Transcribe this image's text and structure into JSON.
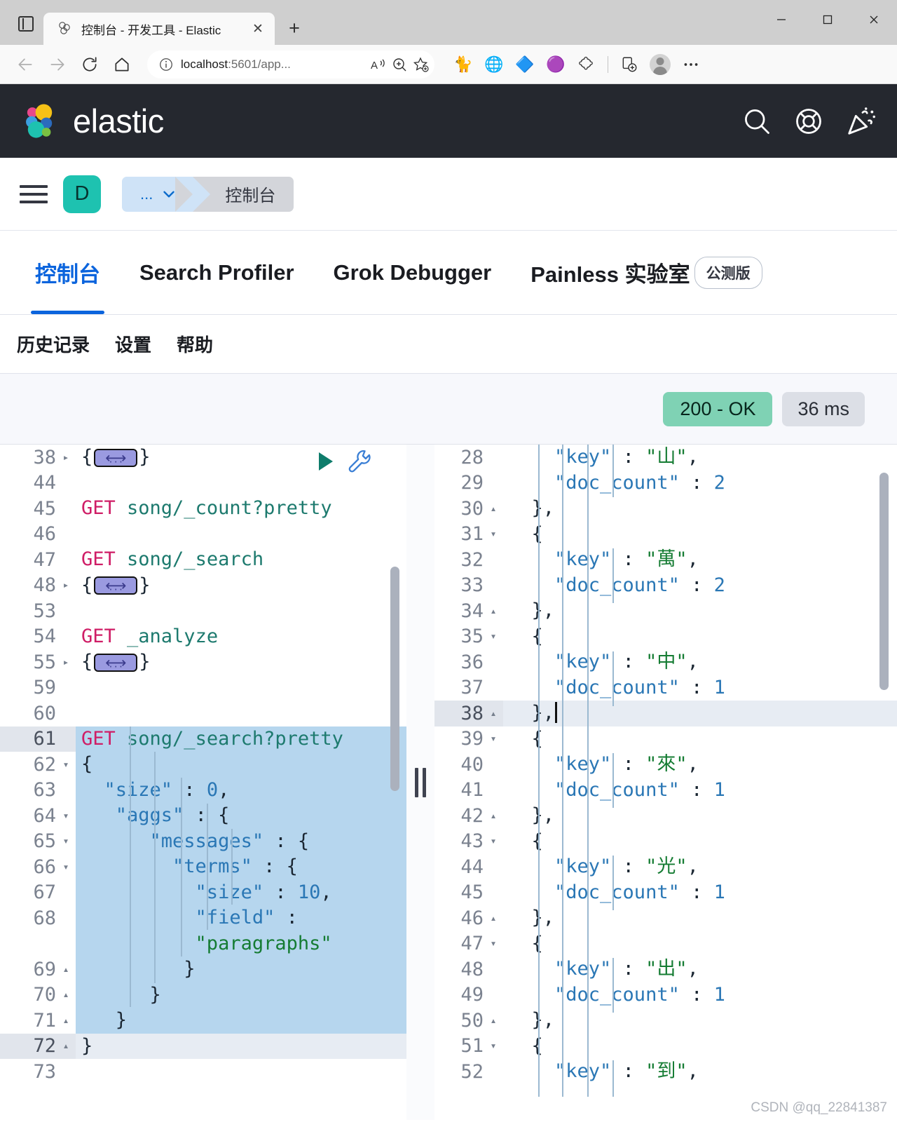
{
  "browser": {
    "tab_title": "控制台 - 开发工具 - Elastic",
    "url_main": "localhost",
    "url_rest": ":5601/app...",
    "new_tab_label": "+",
    "close_label": "✕",
    "back_icon": "back-arrow-icon",
    "forward_icon": "forward-arrow-icon",
    "reload_icon": "reload-icon",
    "home_icon": "home-icon",
    "info_icon": "info-circle-icon",
    "read_aloud_icon": "read-aloud-icon",
    "zoom_icon": "zoom-icon",
    "favorite_icon": "add-favorite-icon",
    "extensions": [
      {
        "name": "cat-extension-icon",
        "glyph": "🐈"
      },
      {
        "name": "idm-extension-icon",
        "glyph": "🌐"
      },
      {
        "name": "diamond-extension-icon",
        "glyph": "🔷"
      },
      {
        "name": "purple-extension-icon",
        "glyph": "🟣"
      },
      {
        "name": "puzzle-extensions-icon",
        "glyph": "🧩"
      }
    ],
    "collections_icon": "collections-icon",
    "profile_icon": "profile-avatar-icon",
    "settings_more_icon": "more-options-icon",
    "window": {
      "minimize": "—",
      "maximize": "▢",
      "close": "✕"
    }
  },
  "elastic_header": {
    "wordmark": "elastic",
    "actions": [
      {
        "name": "search-icon",
        "label": "搜索"
      },
      {
        "name": "help-lifering-icon",
        "label": "帮助"
      },
      {
        "name": "announcements-icon",
        "label": "新功能"
      }
    ]
  },
  "breadcrumb": {
    "menu_icon": "hamburger-menu-icon",
    "space_initial": "D",
    "ellipsis": "...",
    "chevron": "⌄",
    "current": "控制台"
  },
  "app_tabs": {
    "items": [
      {
        "label": "控制台",
        "active": true
      },
      {
        "label": "Search Profiler",
        "active": false
      },
      {
        "label": "Grok Debugger",
        "active": false
      },
      {
        "label": "Painless 实验室",
        "active": false
      }
    ],
    "beta_badge": "公测版"
  },
  "sub_nav": {
    "items": [
      {
        "label": "历史记录"
      },
      {
        "label": "设置"
      },
      {
        "label": "帮助"
      }
    ]
  },
  "status": {
    "response_code": "200 - OK",
    "response_time": "36 ms",
    "ok_color": "#7fd2b4",
    "time_color": "#dcdfe6"
  },
  "editor": {
    "play_icon": "run-request-icon",
    "wrench_icon": "wrench-actions-icon",
    "splitter_icon": "pane-resizer-handle",
    "lines": [
      {
        "n": "38",
        "fold": "▸",
        "segments": [
          {
            "t": "{",
            "c": "punc"
          },
          {
            "t": "FOLD",
            "c": "widget"
          },
          {
            "t": "}",
            "c": "punc"
          }
        ]
      },
      {
        "n": "44",
        "fold": "",
        "segments": []
      },
      {
        "n": "45",
        "fold": "",
        "segments": [
          {
            "t": "GET ",
            "c": "method"
          },
          {
            "t": "song/_count?pretty",
            "c": "url"
          }
        ]
      },
      {
        "n": "46",
        "fold": "",
        "segments": []
      },
      {
        "n": "47",
        "fold": "",
        "segments": [
          {
            "t": "GET ",
            "c": "method"
          },
          {
            "t": "song/_search",
            "c": "url"
          }
        ]
      },
      {
        "n": "48",
        "fold": "▸",
        "segments": [
          {
            "t": "{",
            "c": "punc"
          },
          {
            "t": "FOLD",
            "c": "widget"
          },
          {
            "t": "}",
            "c": "punc"
          }
        ]
      },
      {
        "n": "53",
        "fold": "",
        "segments": []
      },
      {
        "n": "54",
        "fold": "",
        "segments": [
          {
            "t": "GET ",
            "c": "method"
          },
          {
            "t": "_analyze",
            "c": "url"
          }
        ]
      },
      {
        "n": "55",
        "fold": "▸",
        "segments": [
          {
            "t": "{",
            "c": "punc"
          },
          {
            "t": "FOLD",
            "c": "widget"
          },
          {
            "t": "}",
            "c": "punc"
          }
        ]
      },
      {
        "n": "59",
        "fold": "",
        "segments": []
      },
      {
        "n": "60",
        "fold": "",
        "segments": []
      },
      {
        "n": "61",
        "fold": "",
        "active": true,
        "sel": true,
        "segments": [
          {
            "t": "GET ",
            "c": "method"
          },
          {
            "t": "song/_search?pretty",
            "c": "url"
          }
        ]
      },
      {
        "n": "62",
        "fold": "▾",
        "sel": true,
        "segments": [
          {
            "t": "{",
            "c": "punc"
          }
        ]
      },
      {
        "n": "63",
        "fold": "",
        "sel": true,
        "segments": [
          {
            "t": "  \"size\"",
            "c": "key"
          },
          {
            "t": " : ",
            "c": "punc"
          },
          {
            "t": "0",
            "c": "num"
          },
          {
            "t": ",",
            "c": "punc"
          }
        ]
      },
      {
        "n": "64",
        "fold": "▾",
        "sel": true,
        "segments": [
          {
            "t": "   \"aggs\"",
            "c": "key"
          },
          {
            "t": " : {",
            "c": "punc"
          }
        ]
      },
      {
        "n": "65",
        "fold": "▾",
        "sel": true,
        "segments": [
          {
            "t": "      \"messages\"",
            "c": "key"
          },
          {
            "t": " : {",
            "c": "punc"
          }
        ]
      },
      {
        "n": "66",
        "fold": "▾",
        "sel": true,
        "segments": [
          {
            "t": "        \"terms\"",
            "c": "key"
          },
          {
            "t": " : {",
            "c": "punc"
          }
        ]
      },
      {
        "n": "67",
        "fold": "",
        "sel": true,
        "segments": [
          {
            "t": "          \"size\"",
            "c": "key"
          },
          {
            "t": " : ",
            "c": "punc"
          },
          {
            "t": "10",
            "c": "num"
          },
          {
            "t": ",",
            "c": "punc"
          }
        ]
      },
      {
        "n": "68",
        "fold": "",
        "sel": true,
        "segments": [
          {
            "t": "          \"field\"",
            "c": "key"
          },
          {
            "t": " :",
            "c": "punc"
          }
        ]
      },
      {
        "n": "",
        "fold": "",
        "sel": true,
        "segments": [
          {
            "t": "          \"paragraphs\"",
            "c": "str"
          }
        ]
      },
      {
        "n": "69",
        "fold": "▴",
        "sel": true,
        "segments": [
          {
            "t": "         }",
            "c": "punc"
          }
        ]
      },
      {
        "n": "70",
        "fold": "▴",
        "sel": true,
        "segments": [
          {
            "t": "      }",
            "c": "punc"
          }
        ]
      },
      {
        "n": "71",
        "fold": "▴",
        "sel": true,
        "segments": [
          {
            "t": "   }",
            "c": "punc"
          }
        ]
      },
      {
        "n": "72",
        "fold": "▴",
        "cursorline": true,
        "segments": [
          {
            "t": "}",
            "c": "punc"
          }
        ]
      },
      {
        "n": "73",
        "fold": "",
        "segments": []
      }
    ]
  },
  "response": {
    "lines": [
      {
        "n": "28",
        "fold": "",
        "segments": [
          {
            "t": "    \"key\"",
            "c": "key"
          },
          {
            "t": " : ",
            "c": "punc"
          },
          {
            "t": "\"山\"",
            "c": "str"
          },
          {
            "t": ",",
            "c": "punc"
          }
        ]
      },
      {
        "n": "29",
        "fold": "",
        "segments": [
          {
            "t": "    \"doc_count\"",
            "c": "key"
          },
          {
            "t": " : ",
            "c": "punc"
          },
          {
            "t": "2",
            "c": "num"
          }
        ]
      },
      {
        "n": "30",
        "fold": "▴",
        "segments": [
          {
            "t": "  },",
            "c": "punc"
          }
        ]
      },
      {
        "n": "31",
        "fold": "▾",
        "segments": [
          {
            "t": "  {",
            "c": "punc"
          }
        ]
      },
      {
        "n": "32",
        "fold": "",
        "segments": [
          {
            "t": "    \"key\"",
            "c": "key"
          },
          {
            "t": " : ",
            "c": "punc"
          },
          {
            "t": "\"萬\"",
            "c": "str"
          },
          {
            "t": ",",
            "c": "punc"
          }
        ]
      },
      {
        "n": "33",
        "fold": "",
        "segments": [
          {
            "t": "    \"doc_count\"",
            "c": "key"
          },
          {
            "t": " : ",
            "c": "punc"
          },
          {
            "t": "2",
            "c": "num"
          }
        ]
      },
      {
        "n": "34",
        "fold": "▴",
        "segments": [
          {
            "t": "  },",
            "c": "punc"
          }
        ]
      },
      {
        "n": "35",
        "fold": "▾",
        "segments": [
          {
            "t": "  {",
            "c": "punc"
          }
        ]
      },
      {
        "n": "36",
        "fold": "",
        "segments": [
          {
            "t": "    \"key\"",
            "c": "key"
          },
          {
            "t": " : ",
            "c": "punc"
          },
          {
            "t": "\"中\"",
            "c": "str"
          },
          {
            "t": ",",
            "c": "punc"
          }
        ]
      },
      {
        "n": "37",
        "fold": "",
        "segments": [
          {
            "t": "    \"doc_count\"",
            "c": "key"
          },
          {
            "t": " : ",
            "c": "punc"
          },
          {
            "t": "1",
            "c": "num"
          }
        ]
      },
      {
        "n": "38",
        "fold": "▴",
        "cursorline": true,
        "caret": true,
        "segments": [
          {
            "t": "  },",
            "c": "punc"
          }
        ]
      },
      {
        "n": "39",
        "fold": "▾",
        "segments": [
          {
            "t": "  {",
            "c": "punc"
          }
        ]
      },
      {
        "n": "40",
        "fold": "",
        "segments": [
          {
            "t": "    \"key\"",
            "c": "key"
          },
          {
            "t": " : ",
            "c": "punc"
          },
          {
            "t": "\"來\"",
            "c": "str"
          },
          {
            "t": ",",
            "c": "punc"
          }
        ]
      },
      {
        "n": "41",
        "fold": "",
        "segments": [
          {
            "t": "    \"doc_count\"",
            "c": "key"
          },
          {
            "t": " : ",
            "c": "punc"
          },
          {
            "t": "1",
            "c": "num"
          }
        ]
      },
      {
        "n": "42",
        "fold": "▴",
        "segments": [
          {
            "t": "  },",
            "c": "punc"
          }
        ]
      },
      {
        "n": "43",
        "fold": "▾",
        "segments": [
          {
            "t": "  {",
            "c": "punc"
          }
        ]
      },
      {
        "n": "44",
        "fold": "",
        "segments": [
          {
            "t": "    \"key\"",
            "c": "key"
          },
          {
            "t": " : ",
            "c": "punc"
          },
          {
            "t": "\"光\"",
            "c": "str"
          },
          {
            "t": ",",
            "c": "punc"
          }
        ]
      },
      {
        "n": "45",
        "fold": "",
        "segments": [
          {
            "t": "    \"doc_count\"",
            "c": "key"
          },
          {
            "t": " : ",
            "c": "punc"
          },
          {
            "t": "1",
            "c": "num"
          }
        ]
      },
      {
        "n": "46",
        "fold": "▴",
        "segments": [
          {
            "t": "  },",
            "c": "punc"
          }
        ]
      },
      {
        "n": "47",
        "fold": "▾",
        "segments": [
          {
            "t": "  {",
            "c": "punc"
          }
        ]
      },
      {
        "n": "48",
        "fold": "",
        "segments": [
          {
            "t": "    \"key\"",
            "c": "key"
          },
          {
            "t": " : ",
            "c": "punc"
          },
          {
            "t": "\"出\"",
            "c": "str"
          },
          {
            "t": ",",
            "c": "punc"
          }
        ]
      },
      {
        "n": "49",
        "fold": "",
        "segments": [
          {
            "t": "    \"doc_count\"",
            "c": "key"
          },
          {
            "t": " : ",
            "c": "punc"
          },
          {
            "t": "1",
            "c": "num"
          }
        ]
      },
      {
        "n": "50",
        "fold": "▴",
        "segments": [
          {
            "t": "  },",
            "c": "punc"
          }
        ]
      },
      {
        "n": "51",
        "fold": "▾",
        "segments": [
          {
            "t": "  {",
            "c": "punc"
          }
        ]
      },
      {
        "n": "52",
        "fold": "",
        "segments": [
          {
            "t": "    \"key\"",
            "c": "key"
          },
          {
            "t": " : ",
            "c": "punc"
          },
          {
            "t": "\"到\"",
            "c": "str"
          },
          {
            "t": ",",
            "c": "punc"
          }
        ]
      }
    ]
  },
  "watermark": "CSDN @qq_22841387"
}
